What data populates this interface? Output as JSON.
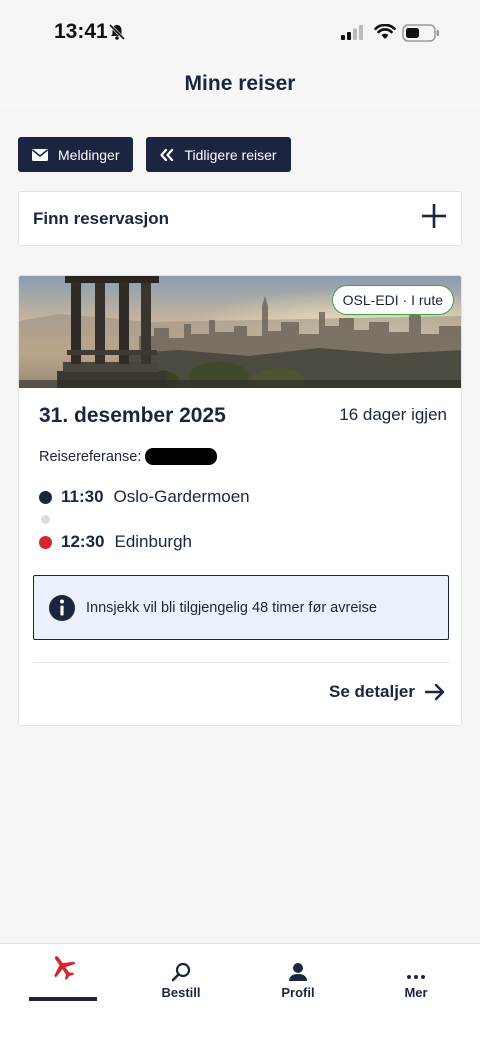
{
  "status_bar": {
    "time": "13:41"
  },
  "header": {
    "title": "Mine reiser"
  },
  "actions": {
    "messages_label": "Meldinger",
    "previous_trips_label": "Tidligere reiser"
  },
  "find_reservation": {
    "label": "Finn reservasjon"
  },
  "trip": {
    "route_badge": "OSL-EDI · I rute",
    "date": "31. desember 2025",
    "days_left": "16 dager igjen",
    "reference_label": "Reisereferanse:",
    "departure": {
      "time": "11:30",
      "airport": "Oslo-Gardermoen"
    },
    "arrival": {
      "time": "12:30",
      "airport": "Edinburgh"
    },
    "checkin_info": "Innsjekk vil bli tilgjengelig 48 timer før avreise",
    "details_label": "Se detaljer"
  },
  "bottom_nav": {
    "items": [
      {
        "label": "",
        "icon": "airplane-icon",
        "active": true
      },
      {
        "label": "Bestill",
        "icon": "search-icon"
      },
      {
        "label": "Profil",
        "icon": "user-icon"
      },
      {
        "label": "Mer",
        "icon": "more-icon"
      }
    ]
  },
  "colors": {
    "navy": "#1b2540",
    "accent_red": "#d8232a",
    "badge_green": "#3ca64a",
    "info_bg": "#eaf1fb"
  }
}
